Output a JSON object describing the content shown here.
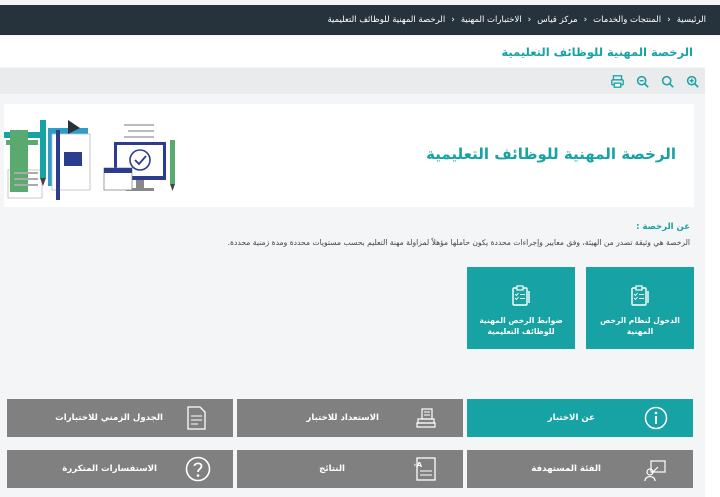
{
  "breadcrumb": [
    "الرئيسية",
    "المنتجات والخدمات",
    "مركز قياس",
    "الاختبارات المهنية",
    "الرخصة المهنية للوظائف التعليمية"
  ],
  "page_title": "الرخصة المهنية للوظائف التعليمية",
  "tools": [
    "print-icon",
    "zoom-out-icon",
    "zoom-reset-icon",
    "zoom-in-icon"
  ],
  "hero": {
    "title": "الرخصة المهنية للوظائف التعليمية"
  },
  "about": {
    "heading": "عن الرخصة :",
    "text": "الرخصة هي وثيقة تصدر من الهيئة، وفق معايير وإجراءات محددة يكون حاملها مؤهلاً لمزاولة مهنة التعليم بحسب مستويات محددة ومدة زمنية محددة."
  },
  "cards": [
    {
      "label_1": "الدخول لنظام الرخص",
      "label_2": "المهنية",
      "icon": "checklist-icon"
    },
    {
      "label_1": "ضوابط الرخص المهنية",
      "label_2": "للوظائف التعليمية",
      "icon": "checklist-icon"
    }
  ],
  "buttons": {
    "about_test": "عن الاختبار",
    "prepare": "الاستعداد للاختبار",
    "schedule": "الجدول الزمني للاختبارات",
    "audience": "الفئة المستهدفة",
    "results": "النتائج",
    "faq": "الاستفسارات المتكررة"
  },
  "colors": {
    "teal": "#17a2a4",
    "gray": "#808080",
    "dark": "#26323c"
  }
}
